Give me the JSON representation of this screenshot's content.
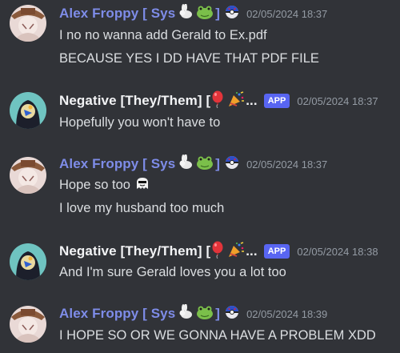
{
  "messages": [
    {
      "author": "Alex Froppy [ Sys",
      "role": "user",
      "timestamp": "02/05/2024 18:37",
      "lines": [
        "I no no wanna add Gerald to Ex.pdf",
        "BECAUSE YES I DD HAVE THAT PDF FILE"
      ]
    },
    {
      "author": "Negative [They/Them] [",
      "role": "app",
      "tag": "APP",
      "timestamp": "02/05/2024 18:37",
      "lines": [
        "Hopefully you won't have to"
      ]
    },
    {
      "author": "Alex Froppy [ Sys",
      "role": "user",
      "timestamp": "02/05/2024 18:37",
      "lines": [
        "Hope so too",
        "I love my husband too much"
      ]
    },
    {
      "author": "Negative [They/Them] [",
      "role": "app",
      "tag": "APP",
      "timestamp": "02/05/2024 18:38",
      "lines": [
        "And I'm sure Gerald loves you a lot too"
      ]
    },
    {
      "author": "Alex Froppy [ Sys",
      "role": "user",
      "timestamp": "02/05/2024 18:39",
      "lines": [
        "I HOPE SO OR WE GONNA HAVE A PROBLEM XDD"
      ]
    }
  ],
  "ellipsis": "...",
  "icons": {
    "rabbit": "rabbit-emoji",
    "frog": "frog-emoji",
    "ball": "pokeball-emoji",
    "balloon": "balloon-emoji",
    "party": "party-popper-emoji",
    "ghost": "ghost-emoji"
  },
  "colors": {
    "background": "#313338",
    "alex_name": "#7e8ce8",
    "negative_name": "#f2f3f5",
    "text": "#dbdee1",
    "timestamp": "#949ba4",
    "app_tag": "#5865f2"
  }
}
